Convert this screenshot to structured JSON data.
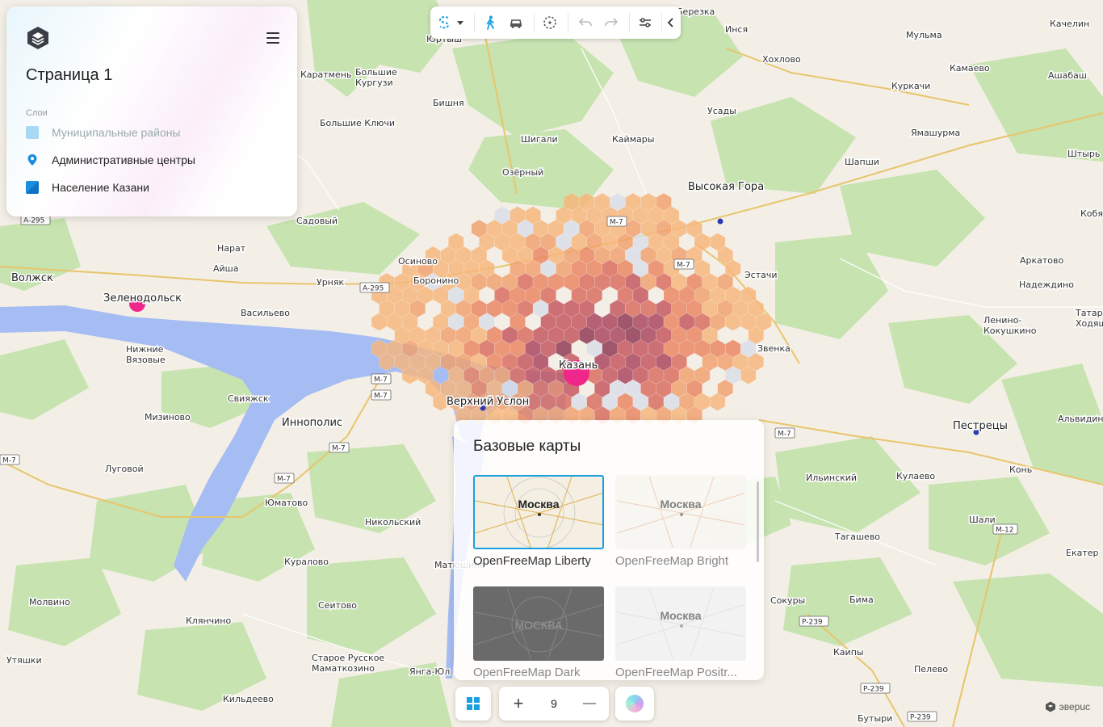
{
  "panel": {
    "title": "Страница 1",
    "layers_label": "Слои",
    "layers": [
      {
        "label": "Муниципальные районы",
        "icon": "square-layer-icon",
        "color": "#a9d8f5",
        "enabled": false
      },
      {
        "label": "Административные центры",
        "icon": "map-pin-icon",
        "color": "#1a8fe0",
        "enabled": true
      },
      {
        "label": "Население Казани",
        "icon": "square-layer-icon",
        "color": "#1a8fe0",
        "enabled": true
      }
    ]
  },
  "toolbar": {
    "tools": [
      {
        "name": "select-tool",
        "icon": "lasso-icon",
        "active": true
      },
      {
        "name": "dropdown",
        "icon": "chevron-down-icon"
      },
      {
        "name": "walk-isochrone",
        "icon": "pedestrian-icon",
        "active": true
      },
      {
        "name": "car-isochrone",
        "icon": "car-icon"
      },
      {
        "name": "radius",
        "icon": "dashed-circle-icon"
      },
      {
        "name": "undo",
        "icon": "undo-icon",
        "disabled": true
      },
      {
        "name": "redo",
        "icon": "redo-icon",
        "disabled": true
      },
      {
        "name": "settings",
        "icon": "sliders-icon"
      },
      {
        "name": "collapse",
        "icon": "chevron-left-icon"
      }
    ]
  },
  "map": {
    "accent": "#f0278a",
    "water": "#a6bdf3",
    "places": [
      {
        "t": "Березка"
      },
      {
        "t": "Инся"
      },
      {
        "t": "Мульма"
      },
      {
        "t": "Качелин"
      },
      {
        "t": "Юртыш"
      },
      {
        "t": "Хохлово"
      },
      {
        "t": "Камаево"
      },
      {
        "t": "Ашабаш"
      },
      {
        "t": "Каратмень"
      },
      {
        "t": "Большие Кургузи"
      },
      {
        "t": "Куркачи"
      },
      {
        "t": "Бишня"
      },
      {
        "t": "Усады"
      },
      {
        "t": "Ямашурма"
      },
      {
        "t": "Большие Ключи"
      },
      {
        "t": "Шигали"
      },
      {
        "t": "Каймары"
      },
      {
        "t": "Штырь"
      },
      {
        "t": "Шапши"
      },
      {
        "t": "Озёрный"
      },
      {
        "t": "Высокая Гора"
      },
      {
        "t": "Кобя"
      },
      {
        "t": "Садовый"
      },
      {
        "t": "Нарат"
      },
      {
        "t": "Осиново"
      },
      {
        "t": "Аркатово"
      },
      {
        "t": "Айша"
      },
      {
        "t": "Надеждино"
      },
      {
        "t": "Эстачи"
      },
      {
        "t": "Волжск"
      },
      {
        "t": "Урняк"
      },
      {
        "t": "Боронино"
      },
      {
        "t": "Зеленодольск"
      },
      {
        "t": "Васильево"
      },
      {
        "t": "Ленино-Кокушкино"
      },
      {
        "t": "Татарские Ходяши"
      },
      {
        "t": "Нижние Вязовые"
      },
      {
        "t": "Звенка"
      },
      {
        "t": "Казань"
      },
      {
        "t": "Свияжск"
      },
      {
        "t": "Верхний Услон"
      },
      {
        "t": "Мизиново"
      },
      {
        "t": "Иннополис"
      },
      {
        "t": "Пестрецы"
      },
      {
        "t": "Альвидино"
      },
      {
        "t": "Луговой"
      },
      {
        "t": "Ильинский"
      },
      {
        "t": "Кулаево"
      },
      {
        "t": "Конь"
      },
      {
        "t": "Юматово"
      },
      {
        "t": "Никольский"
      },
      {
        "t": "Тагашево"
      },
      {
        "t": "Шали"
      },
      {
        "t": "Кураловo"
      },
      {
        "t": "Екатер"
      },
      {
        "t": "Матюшино"
      },
      {
        "t": "Молвино"
      },
      {
        "t": "Сеитово"
      },
      {
        "t": "Сокуры"
      },
      {
        "t": "Бима"
      },
      {
        "t": "Клянчино"
      },
      {
        "t": "Утяшки"
      },
      {
        "t": "Старое Русское Маматкозино"
      },
      {
        "t": "Каипы"
      },
      {
        "t": "Пелево"
      },
      {
        "t": "Янга-Юл"
      },
      {
        "t": "Кильдеево"
      },
      {
        "t": "Бутыри"
      }
    ],
    "roads": [
      "A-295",
      "A-295",
      "M-7",
      "M-7",
      "M-7",
      "M-7",
      "M-7",
      "M-7",
      "M-7",
      "M-7",
      "M-12",
      "P-239",
      "P-239",
      "P-239",
      "M-7"
    ]
  },
  "basemaps": {
    "title": "Базовые карты",
    "items": [
      {
        "name": "OpenFreeMap Liberty",
        "city": "Москва",
        "style": "liberty",
        "selected": true
      },
      {
        "name": "OpenFreeMap Bright",
        "city": "Москва",
        "style": "bright",
        "selected": false
      },
      {
        "name": "OpenFreeMap Dark",
        "city": "МОСКВА",
        "style": "dark",
        "selected": false
      },
      {
        "name": "OpenFreeMap Positr...",
        "city": "Москва",
        "style": "positron",
        "selected": false
      }
    ]
  },
  "controls": {
    "zoom_level": "9",
    "zoom_in": "+",
    "zoom_out": "—"
  },
  "attribution": "эверuc"
}
